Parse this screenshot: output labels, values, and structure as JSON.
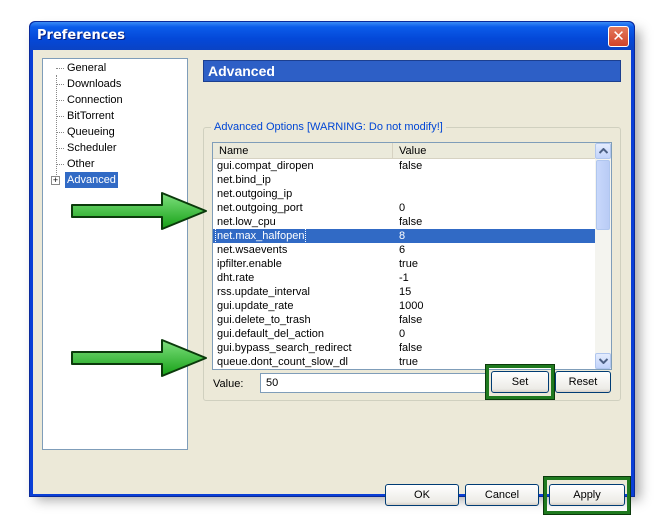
{
  "window": {
    "title": "Preferences",
    "close_glyph": "✕"
  },
  "sidebar": {
    "items": [
      {
        "label": "General"
      },
      {
        "label": "Downloads"
      },
      {
        "label": "Connection"
      },
      {
        "label": "BitTorrent"
      },
      {
        "label": "Queueing"
      },
      {
        "label": "Scheduler"
      },
      {
        "label": "Other"
      },
      {
        "label": "Advanced",
        "selected": true,
        "expander": "+"
      }
    ]
  },
  "section": {
    "title": "Advanced"
  },
  "group": {
    "label": "Advanced Options [WARNING: Do not modify!]"
  },
  "table": {
    "columns": [
      "Name",
      "Value"
    ],
    "rows": [
      [
        "gui.compat_diropen",
        "false"
      ],
      [
        "net.bind_ip",
        ""
      ],
      [
        "net.outgoing_ip",
        ""
      ],
      [
        "net.outgoing_port",
        "0"
      ],
      [
        "net.low_cpu",
        "false"
      ],
      [
        "net.max_halfopen",
        "8"
      ],
      [
        "net.wsaevents",
        "6"
      ],
      [
        "ipfilter.enable",
        "true"
      ],
      [
        "dht.rate",
        "-1"
      ],
      [
        "rss.update_interval",
        "15"
      ],
      [
        "gui.update_rate",
        "1000"
      ],
      [
        "gui.delete_to_trash",
        "false"
      ],
      [
        "gui.default_del_action",
        "0"
      ],
      [
        "gui.bypass_search_redirect",
        "false"
      ],
      [
        "queue.dont_count_slow_dl",
        "true"
      ]
    ],
    "selected_row": "net.max_halfopen"
  },
  "value_field": {
    "label": "Value:",
    "value": "50"
  },
  "buttons": {
    "set": "Set",
    "reset": "Reset",
    "ok": "OK",
    "cancel": "Cancel",
    "apply": "Apply"
  },
  "icons": {
    "scroll_up": "up-arrow-icon",
    "scroll_down": "down-arrow-icon",
    "annotation_arrow": "green-arrow-icon"
  },
  "colors": {
    "highlight_green": "#1f7a1f",
    "arrow_green": "#22b822",
    "selection_blue": "#316ac5",
    "header_blue": "#2d5fc6"
  }
}
